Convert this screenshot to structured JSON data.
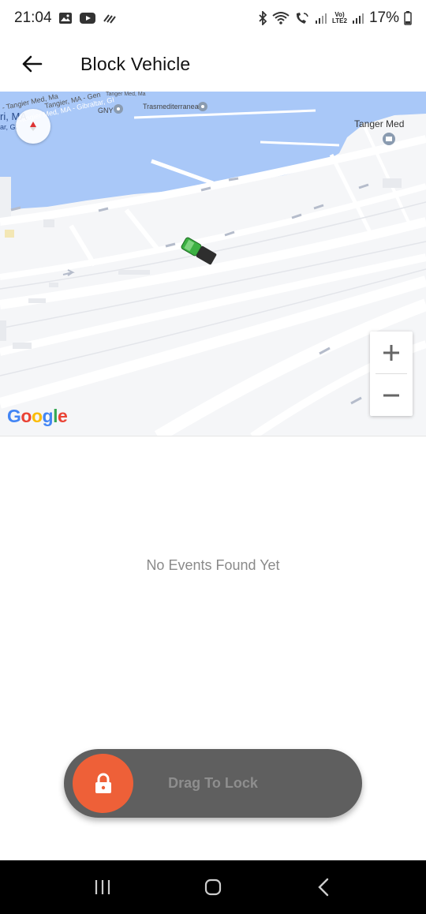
{
  "status_bar": {
    "time": "21:04",
    "battery": "17%",
    "volte_label_top": "Vo)",
    "volte_label_bottom": "LTE2",
    "icons": [
      "gallery-icon",
      "youtube-icon",
      "data-saver-icon",
      "bluetooth-icon",
      "wifi-icon",
      "wifi-call-icon",
      "signal-icon",
      "signal-icon",
      "battery-icon"
    ]
  },
  "app_bar": {
    "title": "Block Vehicle",
    "back_icon": "arrow-back-icon"
  },
  "map": {
    "labels": {
      "gny": "GNY",
      "trasmediterranea": "Trasmediterranea",
      "tanger_med": "Tanger Med",
      "road_1": "- Tangier Med, Ma",
      "road_2": "Tangier Med, MA - Gibraltar, GI",
      "road_3": "Tangier, MA - Gen",
      "road_4": "Tanger Med, Ma",
      "road_5": "ri, MA",
      "road_6": "ar, GI"
    },
    "google_logo": {
      "G": "G",
      "o1": "o",
      "o2": "o",
      "g": "g",
      "l": "l",
      "e": "e"
    },
    "colors": {
      "water": "#a9c8f8",
      "land": "#f5f6f8",
      "road": "#ffffff",
      "vehicle": "#3cb043"
    }
  },
  "empty_state": {
    "text": "No Events Found Yet"
  },
  "slider": {
    "label": "Drag To Lock",
    "knob_color": "#ee6038",
    "track_color": "#5f5f5f",
    "icon": "lock-icon"
  },
  "nav_bar": {
    "icons": [
      "recents-icon",
      "home-icon",
      "back-icon"
    ]
  }
}
